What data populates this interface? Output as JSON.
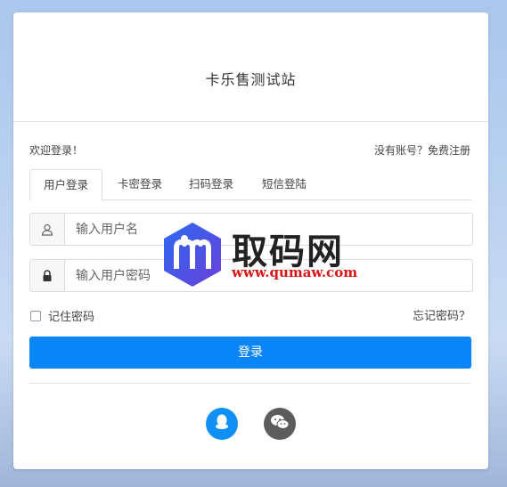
{
  "site": {
    "title": "卡乐售测试站"
  },
  "welcome_text": "欢迎登录！",
  "register_prompt": "没有账号？免费注册",
  "tabs": [
    {
      "label": "用户登录",
      "active": true
    },
    {
      "label": "卡密登录",
      "active": false
    },
    {
      "label": "扫码登录",
      "active": false
    },
    {
      "label": "短信登陆",
      "active": false
    }
  ],
  "form": {
    "username_placeholder": "输入用户名",
    "password_placeholder": "输入用户密码",
    "remember_label": "记住密码",
    "forgot_label": "忘记密码？",
    "login_label": "登录"
  },
  "social": [
    {
      "icon": "qq-icon",
      "color": "#1190f4"
    },
    {
      "icon": "wechat-icon",
      "color": "#5c5c5c"
    }
  ],
  "watermark": {
    "text": "取码网",
    "url": "www.qumaw.com"
  },
  "colors": {
    "primary": "#0a85f7"
  }
}
